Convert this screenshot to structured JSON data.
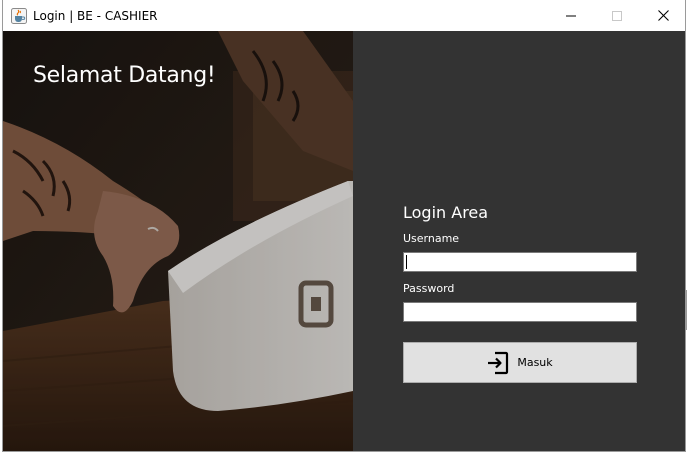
{
  "window": {
    "title": "Login | BE - CASHIER",
    "app_icon": "java-cup-icon",
    "controls": [
      "minimize-icon",
      "maximize-icon",
      "close-icon"
    ]
  },
  "hero": {
    "welcome_text": "Selamat Datang!"
  },
  "login": {
    "title": "Login Area",
    "username_label": "Username",
    "username_value": "",
    "password_label": "Password",
    "password_value": "",
    "submit_label": "Masuk",
    "submit_icon": "login-enter-icon"
  },
  "colors": {
    "panel_bg": "#333333",
    "text_light": "#ffffff",
    "button_bg": "#e1e1e1"
  }
}
